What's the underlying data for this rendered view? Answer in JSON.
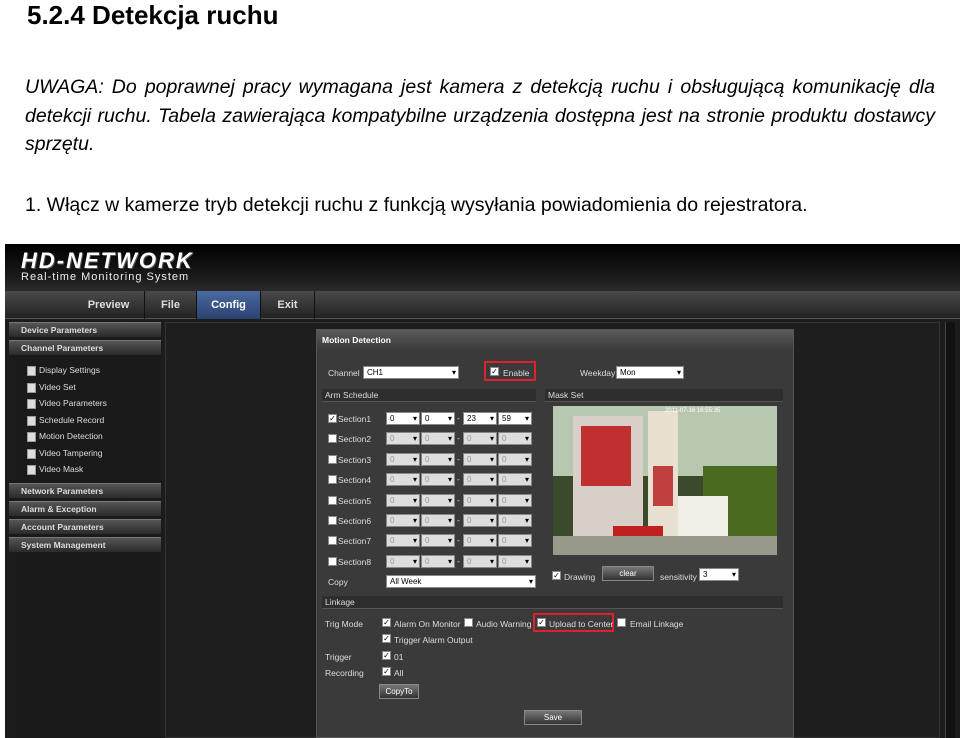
{
  "doc": {
    "title": "5.2.4 Detekcja ruchu",
    "note": "UWAGA: Do poprawnej pracy wymagana jest kamera z  detekcją ruchu i obsługującą komunikację dla detekcji ruchu. Tabela zawierająca kompatybilne urządzenia dostępna jest na stronie produktu dostawcy sprzętu.",
    "step": "1. Włącz w kamerze tryb detekcji ruchu z funkcją wysyłania powiadomienia do rejestratora."
  },
  "app": {
    "logo": "HD-NETWORK",
    "subtitle": "Real-time Monitoring System",
    "menu": [
      "Preview",
      "File",
      "Config",
      "Exit"
    ],
    "active_menu": "Config"
  },
  "sidebar": {
    "heads_top": [
      "Device Parameters",
      "Channel Parameters"
    ],
    "subs": [
      "Display Settings",
      "Video Set",
      "Video Parameters",
      "Schedule Record",
      "Motion Detection",
      "Video Tampering",
      "Video Mask"
    ],
    "heads_bottom": [
      "Network Parameters",
      "Alarm & Exception",
      "Account Parameters",
      "System Management"
    ]
  },
  "panel": {
    "title": "Motion Detection",
    "channel_label": "Channel",
    "channel_value": "CH1",
    "enable_label": "Enable",
    "weekday_label": "Weekday",
    "weekday_value": "Mon",
    "arm_schedule": "Arm Schedule",
    "mask_set": "Mask Set",
    "sections": [
      {
        "label": "Section1",
        "checked": true,
        "v": [
          "0",
          "0",
          "23",
          "59"
        ]
      },
      {
        "label": "Section2",
        "checked": false,
        "v": [
          "0",
          "0",
          "0",
          "0"
        ]
      },
      {
        "label": "Section3",
        "checked": false,
        "v": [
          "0",
          "0",
          "0",
          "0"
        ]
      },
      {
        "label": "Section4",
        "checked": false,
        "v": [
          "0",
          "0",
          "0",
          "0"
        ]
      },
      {
        "label": "Section5",
        "checked": false,
        "v": [
          "0",
          "0",
          "0",
          "0"
        ]
      },
      {
        "label": "Section6",
        "checked": false,
        "v": [
          "0",
          "0",
          "0",
          "0"
        ]
      },
      {
        "label": "Section7",
        "checked": false,
        "v": [
          "0",
          "0",
          "0",
          "0"
        ]
      },
      {
        "label": "Section8",
        "checked": false,
        "v": [
          "0",
          "0",
          "0",
          "0"
        ]
      }
    ],
    "copy_label": "Copy",
    "copy_value": "All Week",
    "drawing_label": "Drawing",
    "clear_label": "clear",
    "sensitivity_label": "sensitivity",
    "sensitivity_value": "3",
    "linkage": "Linkage",
    "trig_mode": "Trig Mode",
    "alarm_on_monitor": "Alarm On Monitor",
    "audio_warning": "Audio Warning",
    "upload_to_center": "Upload to Center",
    "email_linkage": "Email Linkage",
    "trigger_alarm_output": "Trigger Alarm Output",
    "trigger_label": "Trigger",
    "trigger_value": "01",
    "recording_label": "Recording",
    "recording_value": "All",
    "copyto": "CopyTo",
    "save": "Save",
    "cam_timestamp": "2011-07-16 16:55:35"
  }
}
